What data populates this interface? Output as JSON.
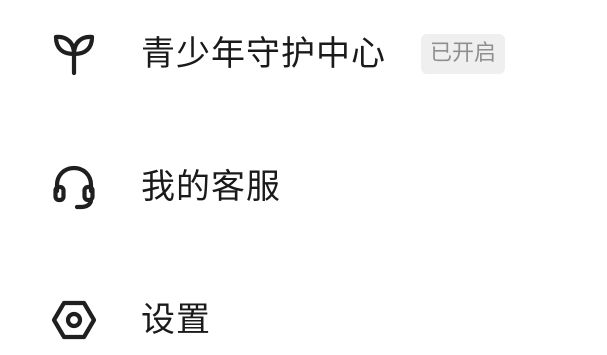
{
  "menu": {
    "items": [
      {
        "icon": "sprout-icon",
        "label": "青少年守护中心",
        "badge": "已开启"
      },
      {
        "icon": "headset-icon",
        "label": "我的客服"
      },
      {
        "icon": "settings-hexagon-icon",
        "label": "设置"
      }
    ]
  },
  "colors": {
    "text": "#1a1a1a",
    "icon": "#1f1f1f",
    "badge_background": "#efefef",
    "badge_text": "#8f8f8f",
    "background": "#ffffff"
  }
}
